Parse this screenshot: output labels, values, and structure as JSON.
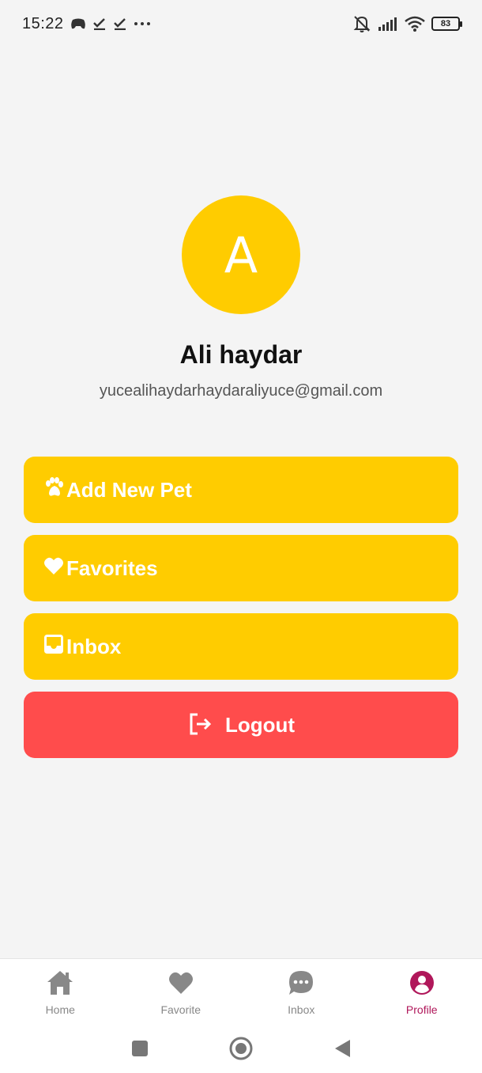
{
  "status_bar": {
    "time": "15:22",
    "battery": "83",
    "left_icons": [
      "game-controller-icon",
      "check-icon",
      "check-icon",
      "more-dots-icon"
    ],
    "right_icons": [
      "mute-icon",
      "signal-icon",
      "wifi-icon",
      "battery-icon"
    ]
  },
  "profile": {
    "avatar_letter": "A",
    "name": "Ali haydar",
    "email": "yucealihaydarhaydaraliyuce@gmail.com"
  },
  "menu": {
    "add_pet": "Add New Pet",
    "favorites": "Favorites",
    "inbox": "Inbox",
    "logout": "Logout"
  },
  "bottom_nav": {
    "items": [
      {
        "label": "Home",
        "icon": "home-icon"
      },
      {
        "label": "Favorite",
        "icon": "heart-icon"
      },
      {
        "label": "Inbox",
        "icon": "chat-icon"
      },
      {
        "label": "Profile",
        "icon": "profile-icon"
      }
    ],
    "active": "Profile"
  },
  "colors": {
    "background": "#f4f4f4",
    "accent_yellow": "#ffcc00",
    "logout_red": "#ff4c4c",
    "active_nav": "#b0175a",
    "inactive_nav": "#888888"
  }
}
